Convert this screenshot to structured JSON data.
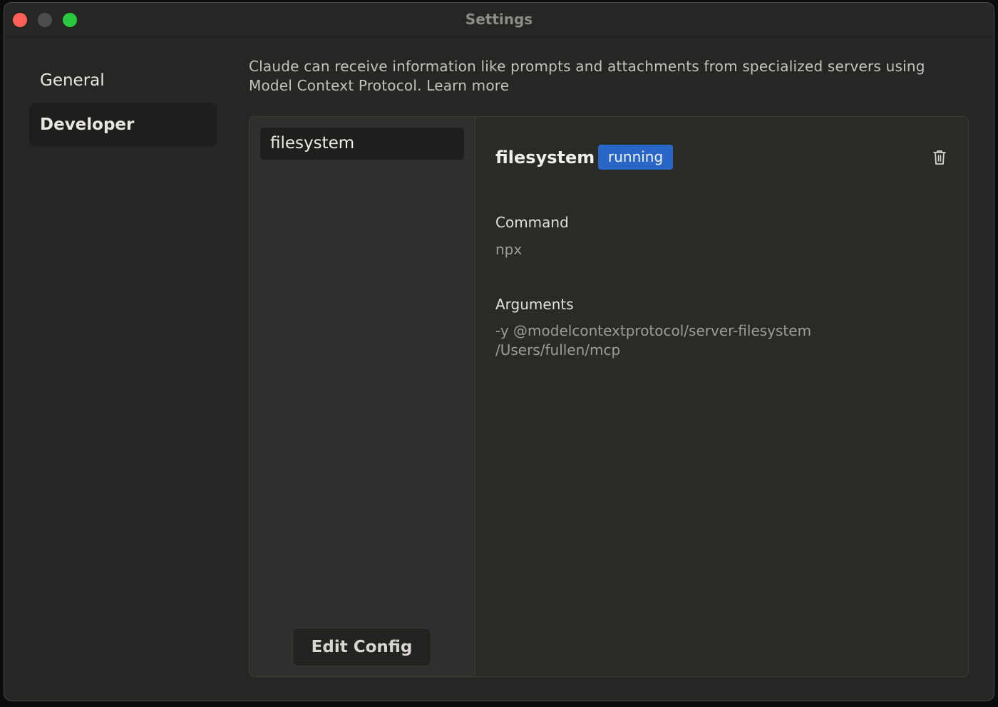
{
  "window": {
    "title": "Settings"
  },
  "sidebar": {
    "items": [
      {
        "label": "General"
      },
      {
        "label": "Developer"
      }
    ]
  },
  "developer": {
    "description": "Claude can receive information like prompts and attachments from specialized servers using Model Context Protocol. Learn more",
    "servers": [
      {
        "name": "filesystem"
      }
    ],
    "edit_config_label": "Edit Config",
    "selected_server": {
      "name": "filesystem",
      "status": "running",
      "command_label": "Command",
      "command": "npx",
      "arguments_label": "Arguments",
      "arguments": "-y @modelcontextprotocol/server-filesystem /Users/fullen/mcp"
    }
  },
  "colors": {
    "status_running": "#2a66c5",
    "close": "#fe5f57",
    "minimize": "#4d4d4b",
    "maximize": "#29c83f"
  },
  "icons": {
    "delete": "trash-icon"
  }
}
